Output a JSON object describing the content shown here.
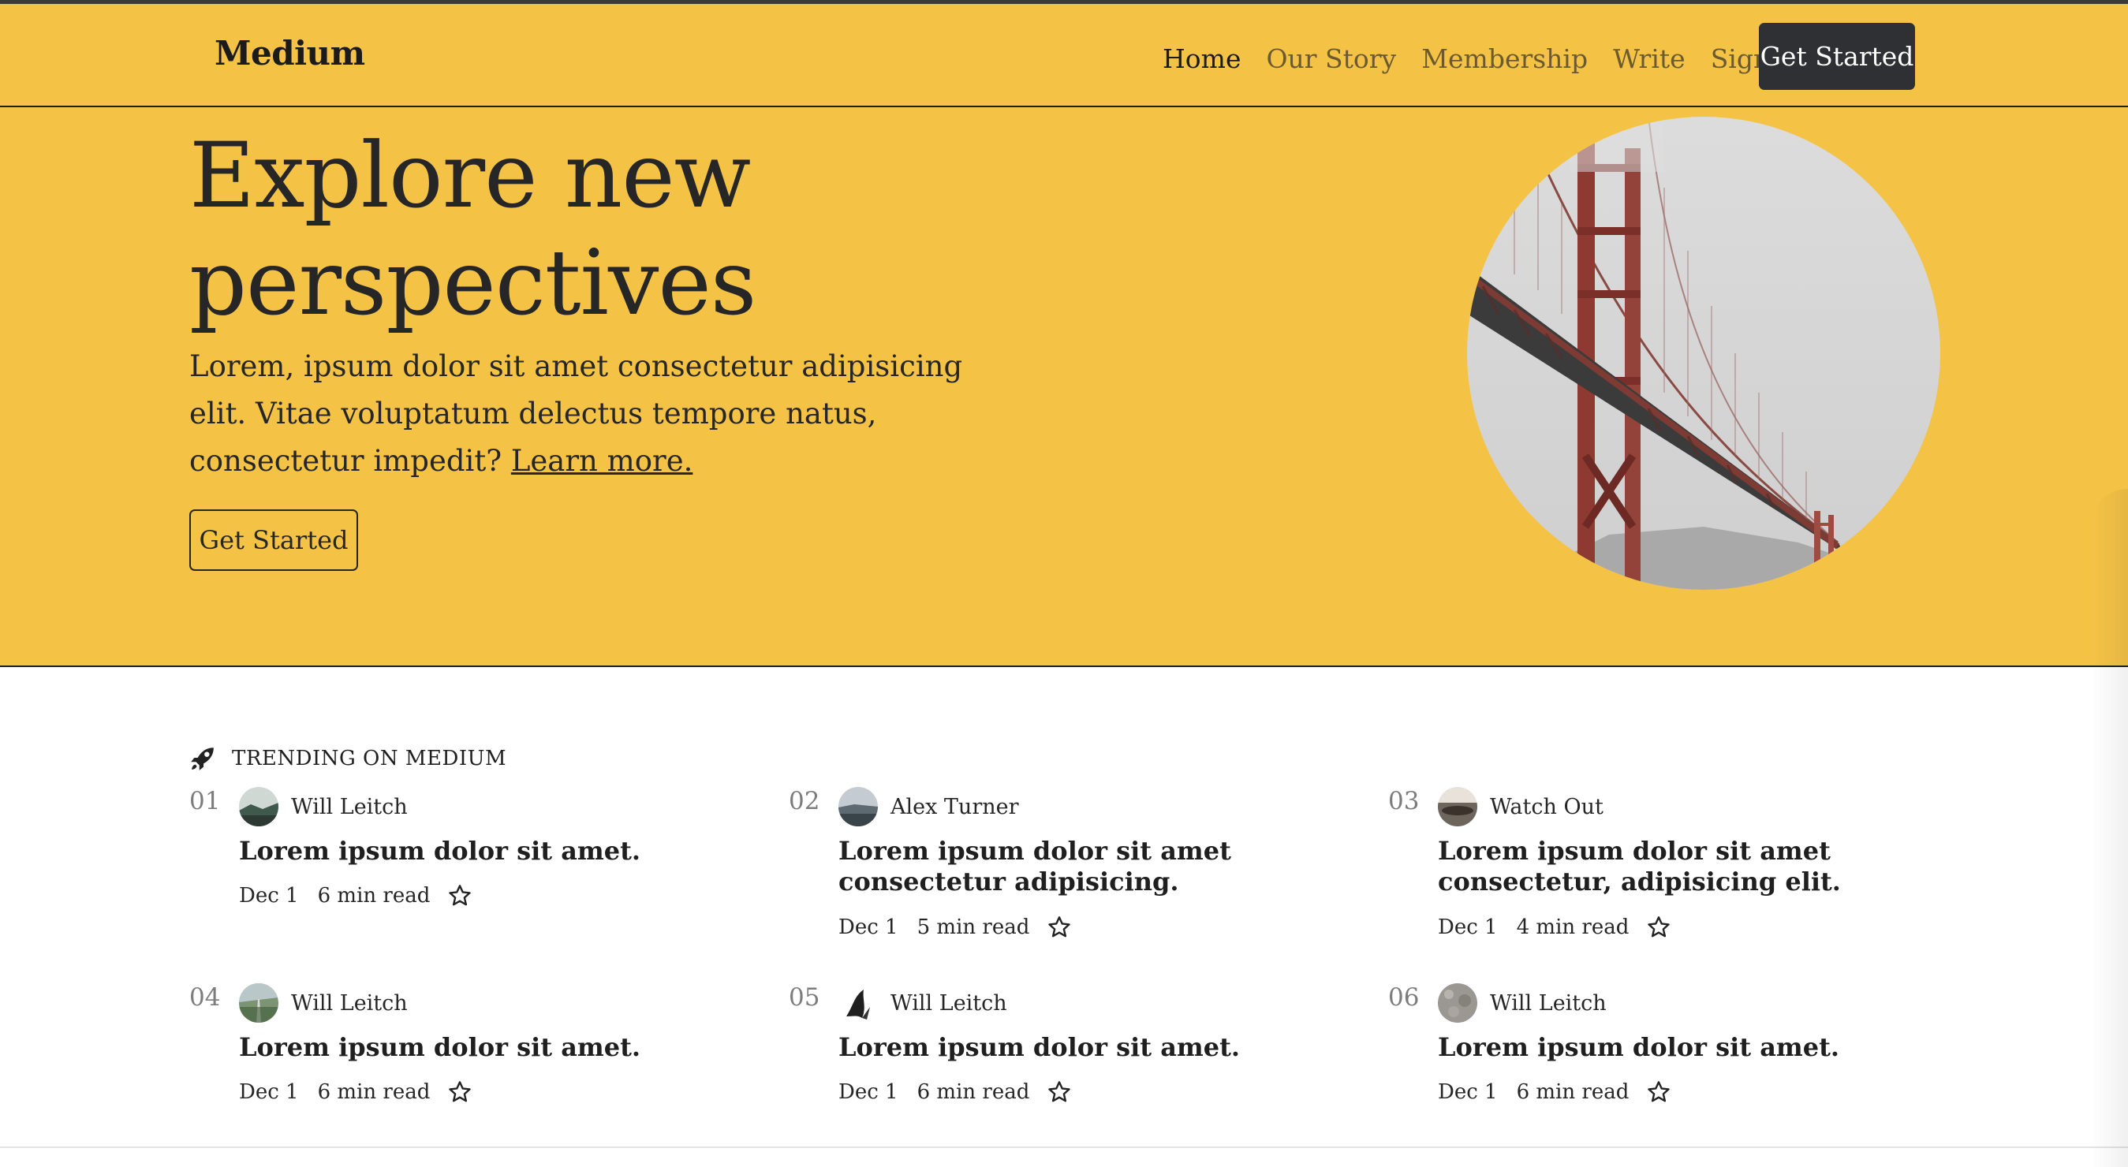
{
  "brand": "Medium",
  "nav": {
    "links": [
      {
        "label": "Home",
        "active": true
      },
      {
        "label": "Our Story",
        "active": false
      },
      {
        "label": "Membership",
        "active": false
      },
      {
        "label": "Write",
        "active": false
      },
      {
        "label": "Sign In",
        "active": false
      }
    ],
    "cta_label": "Get Started"
  },
  "hero": {
    "title_line1": "Explore new",
    "title_line2": "perspectives",
    "description": "Lorem, ipsum dolor sit amet consectetur adipisicing elit. Vitae voluptatum delectus tempore natus, consectetur impedit?",
    "learn_more": "Learn more.",
    "cta_label": "Get Started",
    "image_icon": "golden-gate-bridge-image"
  },
  "trending": {
    "label": "TRENDING ON MEDIUM",
    "icon": "rocket-icon",
    "items": [
      {
        "num": "01",
        "author": "Will Leitch",
        "title": "Lorem ipsum dolor sit amet.",
        "date": "Dec 1",
        "read": "6 min read"
      },
      {
        "num": "02",
        "author": "Alex Turner",
        "title": "Lorem ipsum dolor sit amet consectetur adipisicing.",
        "date": "Dec 1",
        "read": "5 min read"
      },
      {
        "num": "03",
        "author": "Watch Out",
        "title": "Lorem ipsum dolor sit amet consectetur, adipisicing elit.",
        "date": "Dec 1",
        "read": "4 min read"
      },
      {
        "num": "04",
        "author": "Will Leitch",
        "title": "Lorem ipsum dolor sit amet.",
        "date": "Dec 1",
        "read": "6 min read"
      },
      {
        "num": "05",
        "author": "Will Leitch",
        "title": "Lorem ipsum dolor sit amet.",
        "date": "Dec 1",
        "read": "6 min read"
      },
      {
        "num": "06",
        "author": "Will Leitch",
        "title": "Lorem ipsum dolor sit amet.",
        "date": "Dec 1",
        "read": "6 min read"
      }
    ]
  },
  "colors": {
    "hero_bg": "#f4c346",
    "dark_button": "#2f3033",
    "text": "#292929"
  }
}
